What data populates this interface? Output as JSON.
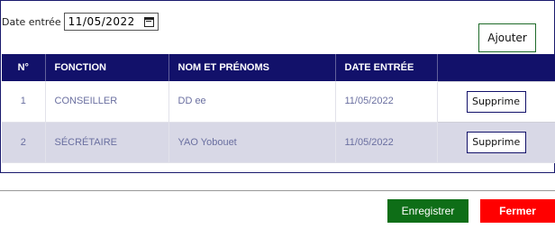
{
  "filter": {
    "date_label": "Date entrée",
    "date_value": "11/05/2022"
  },
  "actions": {
    "add_label": "Ajouter",
    "save_label": "Enregistrer",
    "close_label": "Fermer"
  },
  "table": {
    "headers": [
      "N°",
      "FONCTION",
      "NOM ET PRÉNOMS",
      "DATE ENTRÉE",
      ""
    ],
    "rows": [
      {
        "num": "1",
        "fonction": "CONSEILLER",
        "nom": "DD ee",
        "date": "11/05/2022",
        "action": "Supprime"
      },
      {
        "num": "2",
        "fonction": "SÉCRÉTAIRE",
        "nom": "YAO Yobouet",
        "date": "11/05/2022",
        "action": "Supprime"
      }
    ]
  },
  "colors": {
    "header_bg": "#12116a",
    "save_bg": "#0e6e17",
    "close_bg": "#ff0000",
    "row_alt_bg": "#d8d8e6",
    "cell_text": "#6a6fa0"
  },
  "icons": {
    "date_picker": "calendar-icon"
  }
}
